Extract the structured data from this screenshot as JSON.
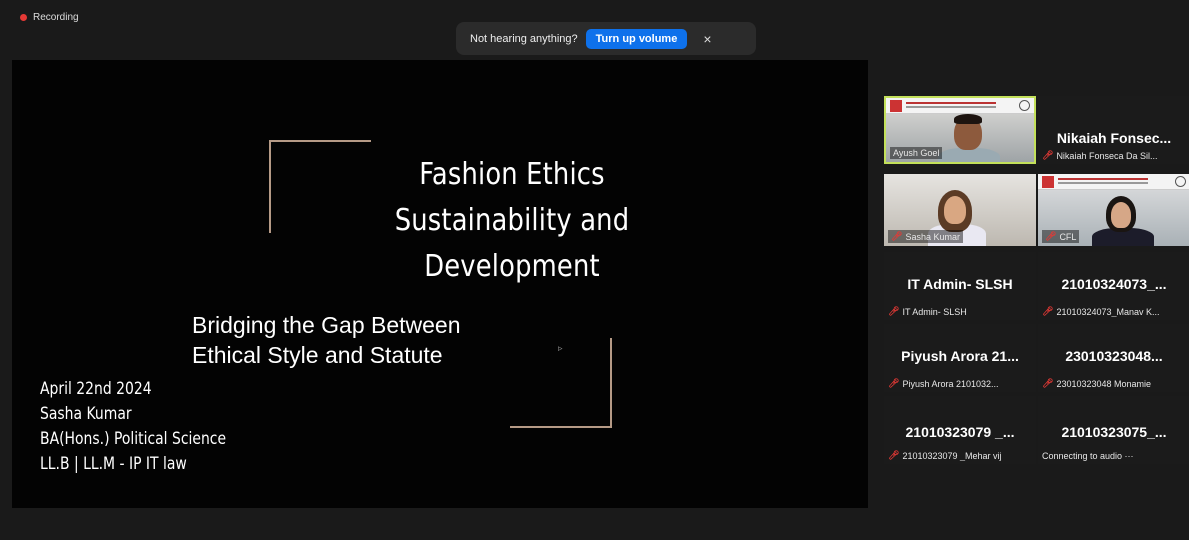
{
  "recording": {
    "label": "Recording"
  },
  "notice": {
    "text": "Not hearing anything?",
    "button_label": "Turn up volume",
    "close_glyph": "×"
  },
  "slide": {
    "title_lines": [
      "Fashion Ethics",
      "Sustainability and",
      "Development"
    ],
    "subtitle_lines": [
      "Bridging the Gap Between",
      "Ethical Style and Statute"
    ],
    "meta_lines": [
      "April 22nd 2024",
      "Sasha Kumar",
      "BA(Hons.) Political Science",
      "LL.B | LL.M - IP IT law"
    ]
  },
  "participants": [
    {
      "type": "video",
      "label": "Ayush Goel",
      "muted": false,
      "active": true
    },
    {
      "type": "name",
      "big": "Nikaiah Fonsec...",
      "label": "Nikaiah Fonseca Da Sil...",
      "muted": true
    },
    {
      "type": "video",
      "label": "Sasha Kumar",
      "muted": true
    },
    {
      "type": "video",
      "label": "CFL",
      "muted": true
    },
    {
      "type": "name",
      "big": "IT Admin- SLSH",
      "label": "IT Admin- SLSH",
      "muted": true
    },
    {
      "type": "name",
      "big": "21010324073_...",
      "label": "21010324073_Manav K...",
      "muted": true
    },
    {
      "type": "name",
      "big": "Piyush Arora 21...",
      "label": "Piyush Arora 2101032...",
      "muted": true
    },
    {
      "type": "name",
      "big": "23010323048...",
      "label": "23010323048 Monamie",
      "muted": true
    },
    {
      "type": "name",
      "big": "21010323079 _...",
      "label": "21010323079 _Mehar vij",
      "muted": true
    },
    {
      "type": "name",
      "big": "21010323075_...",
      "label": "Connecting to audio ···",
      "muted": false
    }
  ],
  "colors": {
    "accent": "#0e71eb",
    "active_border": "#c3e05a",
    "muted": "#e53935",
    "slide_frame": "#b59a86"
  }
}
